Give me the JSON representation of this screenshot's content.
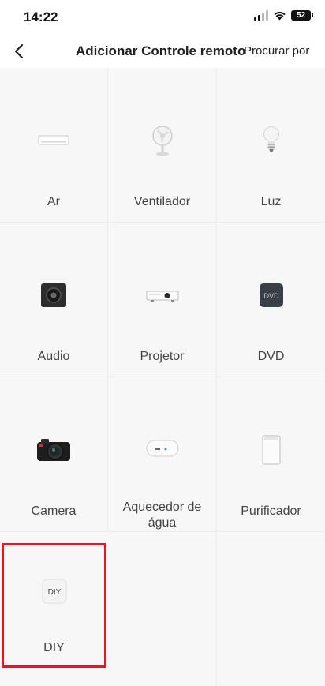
{
  "status_bar": {
    "time": "14:22",
    "battery": "52"
  },
  "nav": {
    "title": "Adicionar Controle remoto",
    "search_label": "Procurar por"
  },
  "devices": [
    {
      "label": "Ar",
      "icon": "air-conditioner-icon"
    },
    {
      "label": "Ventilador",
      "icon": "fan-icon"
    },
    {
      "label": "Luz",
      "icon": "light-bulb-icon"
    },
    {
      "label": "Audio",
      "icon": "speaker-icon"
    },
    {
      "label": "Projetor",
      "icon": "projector-icon"
    },
    {
      "label": "DVD",
      "icon": "dvd-icon"
    },
    {
      "label": "Camera",
      "icon": "camera-icon"
    },
    {
      "label": "Aquecedor de água",
      "icon": "water-heater-icon"
    },
    {
      "label": "Purificador",
      "icon": "purifier-icon"
    },
    {
      "label": "DIY",
      "icon": "diy-icon",
      "icon_text": "DIY"
    }
  ],
  "colors": {
    "highlight": "#e01a24",
    "background": "#f7f7f7"
  }
}
